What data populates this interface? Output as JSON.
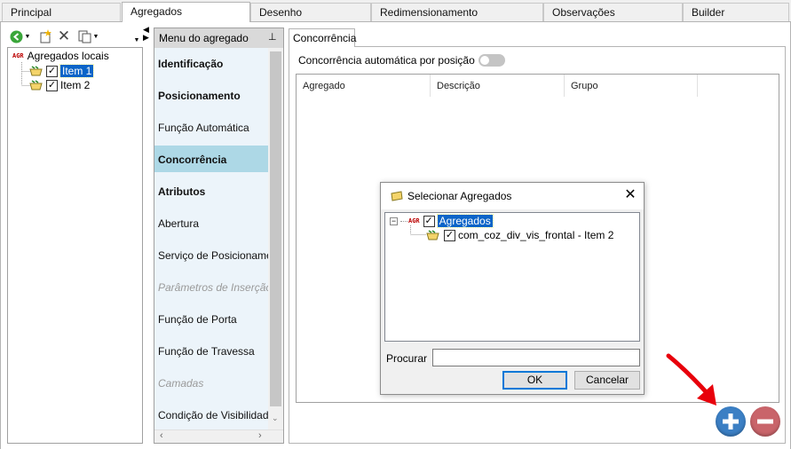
{
  "top_tabs": [
    {
      "label": "Principal"
    },
    {
      "label": "Agregados"
    },
    {
      "label": "Desenho"
    },
    {
      "label": "Redimensionamento"
    },
    {
      "label": "Observações"
    },
    {
      "label": "Builder"
    }
  ],
  "left_tree": {
    "root_prefix": "AGR",
    "root_label": "Agregados locais",
    "items": [
      {
        "label": "Item 1",
        "checked": true,
        "selected": true
      },
      {
        "label": "Item 2",
        "checked": true,
        "selected": false
      }
    ]
  },
  "menu": {
    "header": "Menu do agregado",
    "items": [
      {
        "label": "Identificação"
      },
      {
        "label": "Posicionamento"
      },
      {
        "label": "Função Automática"
      },
      {
        "label": "Concorrência"
      },
      {
        "label": "Atributos"
      },
      {
        "label": "Abertura"
      },
      {
        "label": "Serviço de Posicionamento"
      },
      {
        "label": "Parâmetros de Inserção"
      },
      {
        "label": "Função de Porta"
      },
      {
        "label": "Função de Travessa"
      },
      {
        "label": "Camadas"
      },
      {
        "label": "Condição de Visibilidade"
      }
    ],
    "active_item": "Concorrência"
  },
  "right": {
    "tab_label": "Concorrência",
    "toggle_label": "Concorrência automática por posição",
    "toggle_on": false,
    "columns": [
      "Agregado",
      "Descrição",
      "Grupo"
    ]
  },
  "dialog": {
    "title": "Selecionar Agregados",
    "tree_root_prefix": "AGR",
    "tree_root_label": "Agregados",
    "tree_child_label": "com_coz_div_vis_frontal - Item 2",
    "search_label": "Procurar",
    "search_value": "",
    "ok_label": "OK",
    "cancel_label": "Cancelar"
  },
  "colors": {
    "add_button": "#3b7fc4",
    "remove_button": "#c9646a",
    "annotation_arrow": "#e8000b",
    "active_menu": "#add8e6"
  }
}
